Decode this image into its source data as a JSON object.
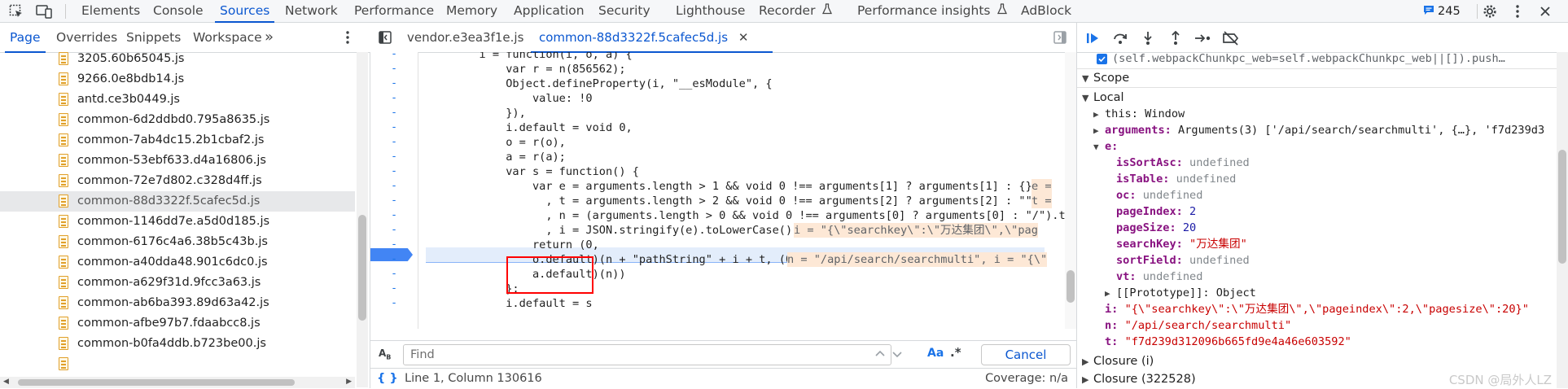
{
  "top_tabs": [
    "Elements",
    "Console",
    "Sources",
    "Network",
    "Performance",
    "Memory",
    "Application",
    "Security",
    "Lighthouse",
    "Recorder",
    "Performance insights",
    "AdBlock"
  ],
  "active_top_tab": "Sources",
  "issues_badge": "245",
  "nav_tabs": [
    "Page",
    "Overrides",
    "Snippets",
    "Workspace"
  ],
  "nav_more": "»",
  "files": [
    "3205.60b65045.js",
    "9266.0e8bdb14.js",
    "antd.ce3b0449.js",
    "common-6d2ddbd0.795a8635.js",
    "common-7ab4dc15.2b1cbaf2.js",
    "common-53ebf633.d4a16806.js",
    "common-72e7d802.c328d4ff.js",
    "common-88d3322f.5cafec5d.js",
    "common-1146dd7e.a5d0d185.js",
    "common-6176c4a6.38b5c43b.js",
    "common-a40dda48.901c6dc0.js",
    "common-a629f31d.9fcc3a63.js",
    "common-ab6ba393.89d63a42.js",
    "common-afbe97b7.fdaabcc8.js",
    "common-b0fa4ddb.b723be00.js"
  ],
  "selected_file": "common-88d3322f.5cafec5d.js",
  "editor_tabs": [
    "vendor.e3ea3f1e.js",
    "common-88d3322f.5cafec5d.js"
  ],
  "code_lines": [
    {
      "gutter": "-",
      "text": "        i = function(i, o, a) {"
    },
    {
      "gutter": "-",
      "text": "            var r = n(856562);"
    },
    {
      "gutter": "-",
      "text": "            Object.defineProperty(i, \"__esModule\", {"
    },
    {
      "gutter": "-",
      "text": "                value: !0"
    },
    {
      "gutter": "-",
      "text": "            }),"
    },
    {
      "gutter": "-",
      "text": "            i.default = void 0,"
    },
    {
      "gutter": "-",
      "text": "            o = r(o),"
    },
    {
      "gutter": "-",
      "text": "            a = r(a);"
    },
    {
      "gutter": "-",
      "text": "            var s = function() {"
    },
    {
      "gutter": "-",
      "text": "                var e = arguments.length > 1 && void 0 !== arguments[1] ? arguments[1] : {}"
    },
    {
      "gutter": "-",
      "text": "                  , t = arguments.length > 2 && void 0 !== arguments[2] ? arguments[2] : \"\""
    },
    {
      "gutter": "-",
      "text": "                  , n = (arguments.length > 0 && void 0 !== arguments[0] ? arguments[0] : \"/\").t"
    },
    {
      "gutter": "-",
      "text": "                  , i = JSON.stringify(e).toLowerCase();"
    },
    {
      "gutter": "-",
      "text": "                return (0,"
    },
    {
      "gutter": "-",
      "text": "                o.default)(n + \"pathString\" + i + t, (0,"
    },
    {
      "gutter": "-",
      "text": "                a.default)(n))"
    },
    {
      "gutter": "-",
      "text": "            };"
    },
    {
      "gutter": "-",
      "text": "            i.default = s"
    }
  ],
  "inline_values": {
    "line9": "e =",
    "line10": "t =",
    "line12": "i = \"{\\\"searchkey\\\":\\\"万达集团\\\",\\\"pag",
    "line14": "n = \"/api/search/searchmulti\", i = \"{\\\""
  },
  "find": {
    "placeholder": "Find",
    "aa": "Aa",
    "regex": ".*",
    "cancel": "Cancel"
  },
  "status": {
    "position": "Line 1, Column 130616",
    "coverage": "Coverage: n/a"
  },
  "scope": {
    "top_line": "(self.webpackChunkpc_web=self.webpackChunkpc_web||[]).push…",
    "section": "Scope",
    "local": "Local",
    "this_key": "this:",
    "this_val": "Window",
    "arguments_key": "arguments:",
    "arguments_val": "Arguments(3) ['/api/search/searchmulti', {…}, 'f7d239d3",
    "e_key": "e:",
    "e_props": [
      {
        "key": "isSortAsc:",
        "value": "undefined",
        "type": "und"
      },
      {
        "key": "isTable:",
        "value": "undefined",
        "type": "und"
      },
      {
        "key": "oc:",
        "value": "undefined",
        "type": "und"
      },
      {
        "key": "pageIndex:",
        "value": "2",
        "type": "num"
      },
      {
        "key": "pageSize:",
        "value": "20",
        "type": "num"
      },
      {
        "key": "searchKey:",
        "value": "\"万达集团\"",
        "type": "str"
      },
      {
        "key": "sortField:",
        "value": "undefined",
        "type": "und"
      },
      {
        "key": "vt:",
        "value": "undefined",
        "type": "und"
      }
    ],
    "prototype": "[[Prototype]]: Object",
    "i_key": "i:",
    "i_val": "\"{\\\"searchkey\\\":\\\"万达集团\\\",\\\"pageindex\\\":2,\\\"pagesize\\\":20}\"",
    "n_key": "n:",
    "n_val": "\"/api/search/searchmulti\"",
    "t_key": "t:",
    "t_val": "\"f7d239d312096b665fd9e4a46e603592\"",
    "closure1": "Closure (i)",
    "closure2": "Closure (322528)"
  },
  "watermark": "CSDN @局外人LZ"
}
